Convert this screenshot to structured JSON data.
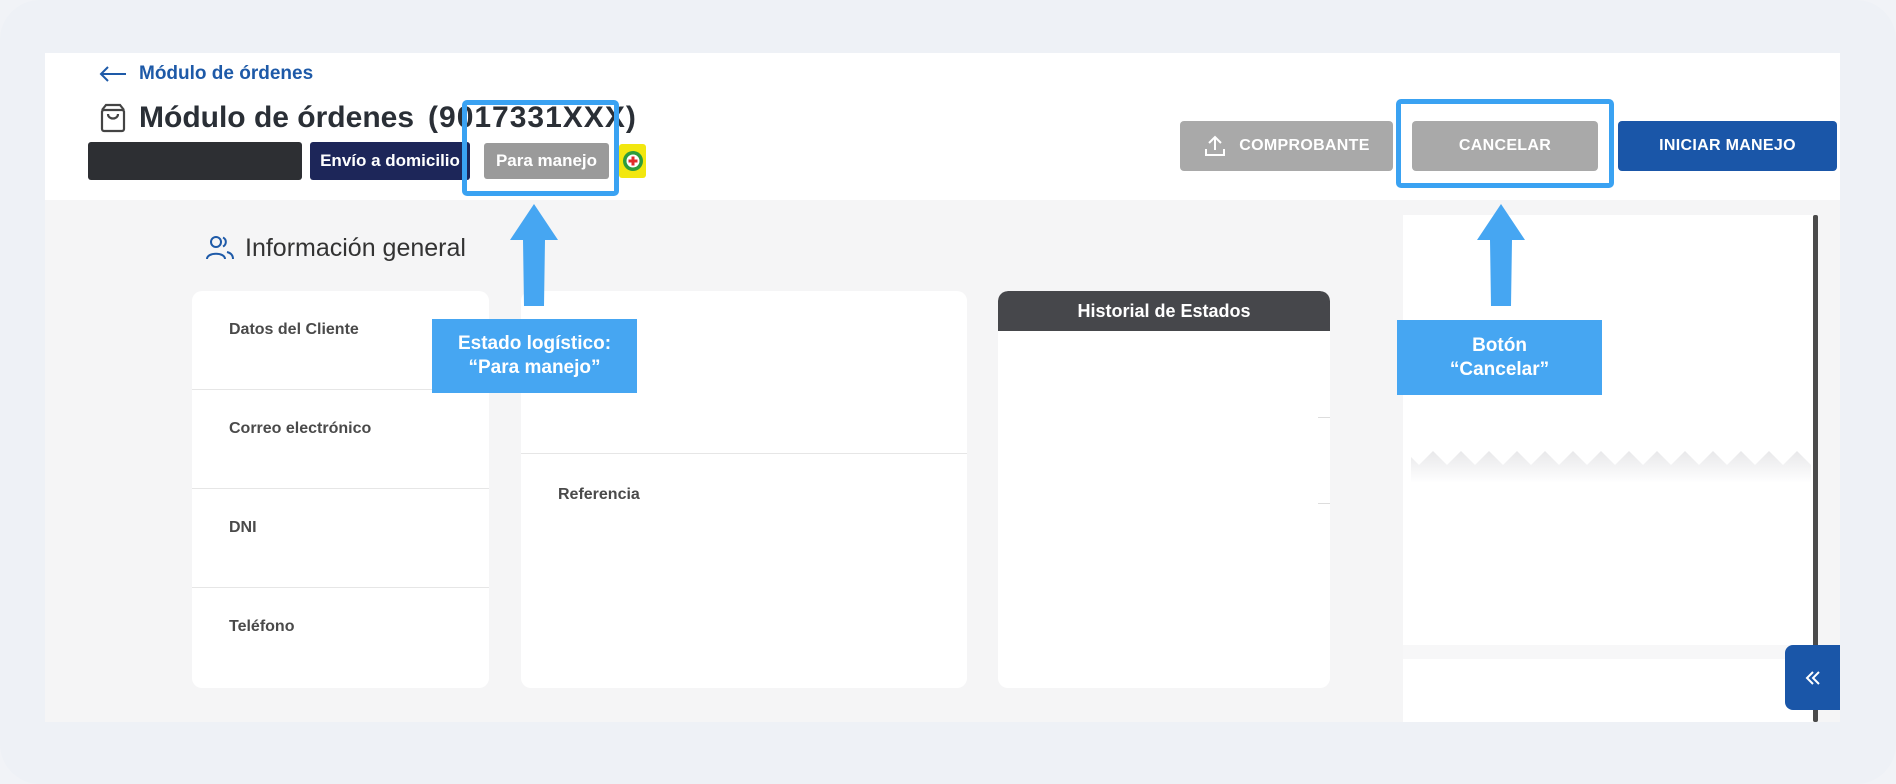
{
  "header": {
    "back_label": "Módulo de órdenes",
    "title": "Módulo de órdenes",
    "order_id": "(9017331XXX)",
    "badges": {
      "delivery": "Envío a domicilio",
      "status": "Para manejo"
    },
    "buttons": {
      "comprobante": "COMPROBANTE",
      "cancelar": "CANCELAR",
      "iniciar": "INICIAR MANEJO"
    }
  },
  "section": {
    "title": "Información general"
  },
  "customer_fields": [
    {
      "label": "Datos del Cliente"
    },
    {
      "label": "Correo electrónico"
    },
    {
      "label": "DNI"
    },
    {
      "label": "Teléfono"
    }
  ],
  "address_card": {
    "reference_label": "Referencia"
  },
  "history": {
    "title": "Historial de Estados"
  },
  "annotations": {
    "status_line1": "Estado logístico:",
    "status_line2": "“Para manejo”",
    "cancel_line1": "Botón",
    "cancel_line2": "“Cancelar”"
  },
  "colors": {
    "primary": "#1a56a8",
    "annotation": "#46a6f2",
    "disabled": "#a9a9a9",
    "delivery_badge": "#1d2659"
  }
}
